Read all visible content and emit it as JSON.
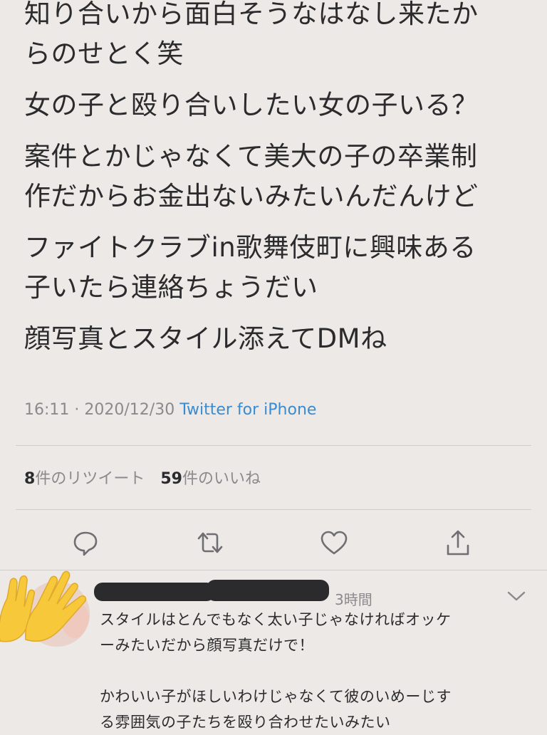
{
  "tweet": {
    "paragraphs": [
      "知り合いから面白そうなはなし来たか\nらのせとく笑",
      "女の子と殴り合いしたい女の子いる？",
      "案件とかじゃなくて美大の子の卒業制\n作だからお金出ないみたいんだんけど",
      "ファイトクラブin歌舞伎町に興味ある\n子いたら連絡ちょうだい",
      "顔写真とスタイル添えてDMね"
    ],
    "time": "16:11",
    "separator": " · ",
    "date": "2020/12/30",
    "source": "Twitter for iPhone"
  },
  "stats": {
    "retweet_count": "8",
    "retweet_label": "件のリツイート",
    "like_count": "59",
    "like_label": "件のいいね"
  },
  "actions": {
    "icons": [
      "reply-icon",
      "retweet-icon",
      "like-icon",
      "share-icon"
    ]
  },
  "reply": {
    "time": "3時間",
    "text": "スタイルはとんでもなく太い子じゃなければオッケ\nーみたいだから顔写真だけで！\n\nかわいい子がほしいわけじゃなくて彼のいめーじす\nる雰囲気の子たちを殴り合わせたいみたい"
  },
  "colors": {
    "background": "#ece9e6",
    "text": "#2b2b2d",
    "muted": "#8a8a8d",
    "link": "#3a8cd0",
    "icon": "#6f6f73"
  }
}
